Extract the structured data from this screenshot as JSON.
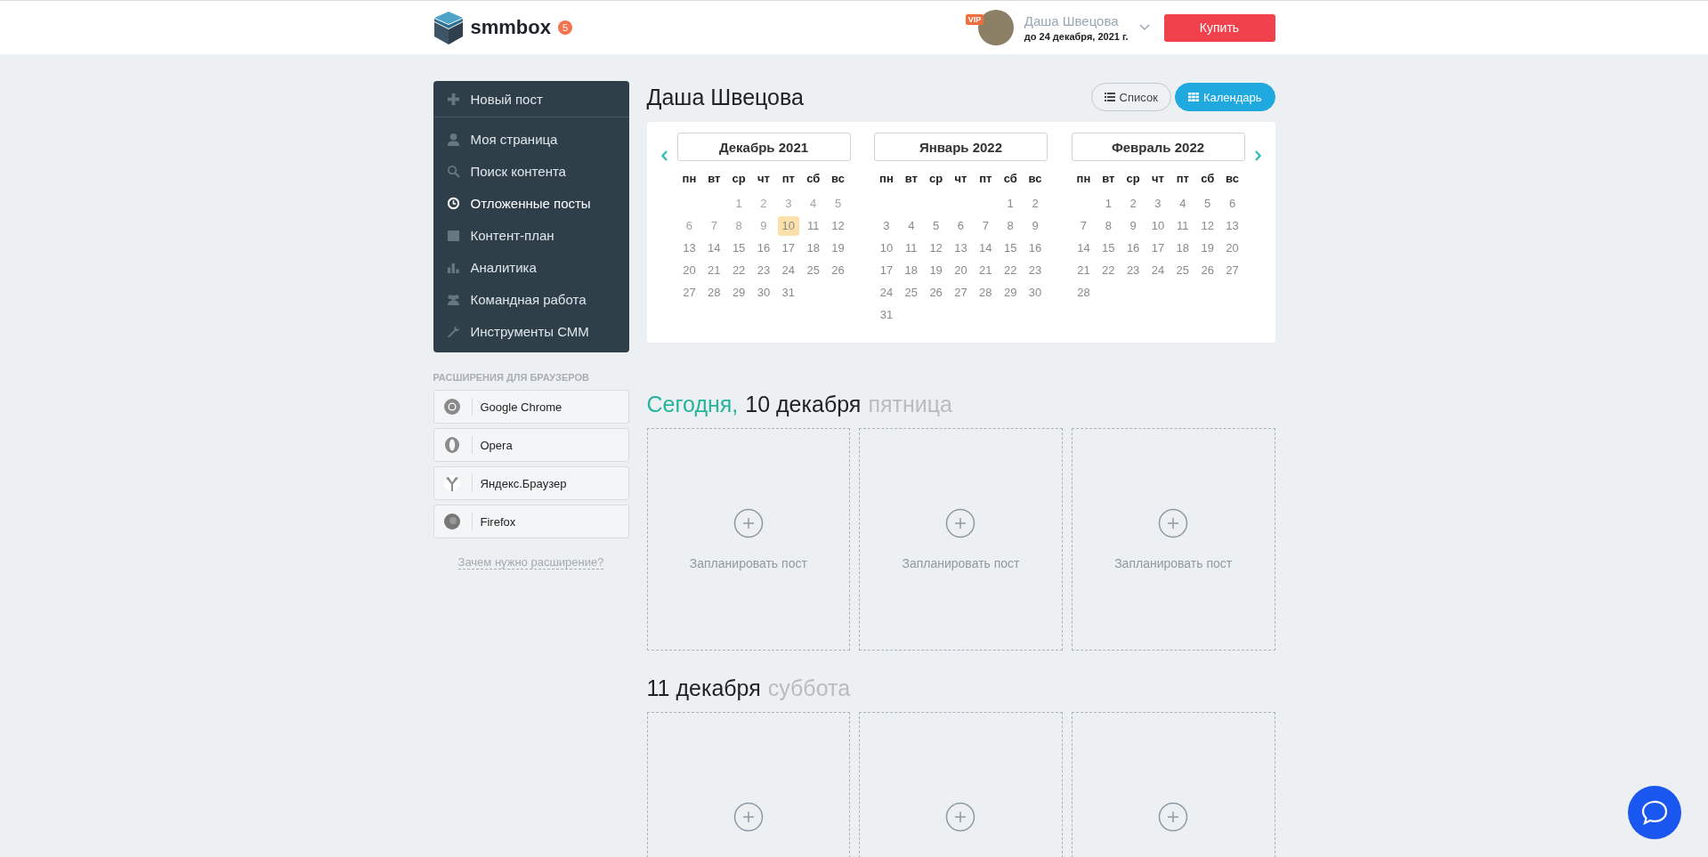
{
  "header": {
    "logo_text": "smmbox",
    "notification_count": "5",
    "vip_badge": "VIP",
    "user_name": "Даша Швецова",
    "subscription": "до 24 декабря, 2021 г.",
    "buy_button": "Купить"
  },
  "sidebar": {
    "items": [
      {
        "label": "Новый пост",
        "kind": "action",
        "selected": false
      },
      {
        "label": "Моя страница",
        "kind": "link",
        "selected": false
      },
      {
        "label": "Поиск контента",
        "kind": "link",
        "selected": false
      },
      {
        "label": "Отложенные посты",
        "kind": "link",
        "selected": true
      },
      {
        "label": "Контент-план",
        "kind": "link",
        "selected": false
      },
      {
        "label": "Аналитика",
        "kind": "link",
        "selected": false
      },
      {
        "label": "Командная работа",
        "kind": "link",
        "selected": false
      },
      {
        "label": "Инструменты СММ",
        "kind": "link",
        "selected": false
      }
    ],
    "extensions_heading": "РАСШИРЕНИЯ ДЛЯ БРАУЗЕРОВ",
    "extensions": [
      "Google Chrome",
      "Opera",
      "Яндекс.Браузер",
      "Firefox"
    ],
    "extensions_link": "Зачем нужно расширение?"
  },
  "page_title": "Даша Швецова",
  "view_tabs": [
    {
      "label": "Список",
      "selected": false
    },
    {
      "label": "Календарь",
      "selected": true
    }
  ],
  "months": [
    {
      "title": "Декабрь 2021",
      "weekdays": [
        "пн",
        "вт",
        "ср",
        "чт",
        "пт",
        "сб",
        "вс"
      ],
      "weeks": [
        [
          {
            "day": "1",
            "past": true,
            "selected": false
          },
          {
            "day": "2",
            "past": true,
            "selected": false
          },
          {
            "day": "3",
            "past": true,
            "selected": false
          },
          {
            "day": "4",
            "past": true,
            "selected": false
          },
          {
            "day": "5",
            "past": true,
            "selected": false
          }
        ],
        [
          {
            "day": "6",
            "past": true,
            "selected": false
          },
          {
            "day": "7",
            "past": true,
            "selected": false
          },
          {
            "day": "8",
            "past": true,
            "selected": false
          },
          {
            "day": "9",
            "past": true,
            "selected": false
          },
          {
            "day": "10",
            "past": false,
            "selected": true
          },
          {
            "day": "11",
            "past": false,
            "selected": false
          },
          {
            "day": "12",
            "past": false,
            "selected": false
          }
        ],
        [
          {
            "day": "13",
            "past": false,
            "selected": false
          },
          {
            "day": "14",
            "past": false,
            "selected": false
          },
          {
            "day": "15",
            "past": false,
            "selected": false
          },
          {
            "day": "16",
            "past": false,
            "selected": false
          },
          {
            "day": "17",
            "past": false,
            "selected": false
          },
          {
            "day": "18",
            "past": false,
            "selected": false
          },
          {
            "day": "19",
            "past": false,
            "selected": false
          }
        ],
        [
          {
            "day": "20",
            "past": false,
            "selected": false
          },
          {
            "day": "21",
            "past": false,
            "selected": false
          },
          {
            "day": "22",
            "past": false,
            "selected": false
          },
          {
            "day": "23",
            "past": false,
            "selected": false
          },
          {
            "day": "24",
            "past": false,
            "selected": false
          },
          {
            "day": "25",
            "past": false,
            "selected": false
          },
          {
            "day": "26",
            "past": false,
            "selected": false
          }
        ],
        [
          {
            "day": "27",
            "past": false,
            "selected": false
          },
          {
            "day": "28",
            "past": false,
            "selected": false
          },
          {
            "day": "29",
            "past": false,
            "selected": false
          },
          {
            "day": "30",
            "past": false,
            "selected": false
          },
          {
            "day": "31",
            "past": false,
            "selected": false
          }
        ]
      ]
    },
    {
      "title": "Январь 2022",
      "weekdays": [
        "пн",
        "вт",
        "ср",
        "чт",
        "пт",
        "сб",
        "вс"
      ],
      "weeks": [
        [
          {
            "day": "1",
            "past": false,
            "selected": false
          },
          {
            "day": "2",
            "past": false,
            "selected": false
          }
        ],
        [
          {
            "day": "3",
            "past": false,
            "selected": false
          },
          {
            "day": "4",
            "past": false,
            "selected": false
          },
          {
            "day": "5",
            "past": false,
            "selected": false
          },
          {
            "day": "6",
            "past": false,
            "selected": false
          },
          {
            "day": "7",
            "past": false,
            "selected": false
          },
          {
            "day": "8",
            "past": false,
            "selected": false
          },
          {
            "day": "9",
            "past": false,
            "selected": false
          }
        ],
        [
          {
            "day": "10",
            "past": false,
            "selected": false
          },
          {
            "day": "11",
            "past": false,
            "selected": false
          },
          {
            "day": "12",
            "past": false,
            "selected": false
          },
          {
            "day": "13",
            "past": false,
            "selected": false
          },
          {
            "day": "14",
            "past": false,
            "selected": false
          },
          {
            "day": "15",
            "past": false,
            "selected": false
          },
          {
            "day": "16",
            "past": false,
            "selected": false
          }
        ],
        [
          {
            "day": "17",
            "past": false,
            "selected": false
          },
          {
            "day": "18",
            "past": false,
            "selected": false
          },
          {
            "day": "19",
            "past": false,
            "selected": false
          },
          {
            "day": "20",
            "past": false,
            "selected": false
          },
          {
            "day": "21",
            "past": false,
            "selected": false
          },
          {
            "day": "22",
            "past": false,
            "selected": false
          },
          {
            "day": "23",
            "past": false,
            "selected": false
          }
        ],
        [
          {
            "day": "24",
            "past": false,
            "selected": false
          },
          {
            "day": "25",
            "past": false,
            "selected": false
          },
          {
            "day": "26",
            "past": false,
            "selected": false
          },
          {
            "day": "27",
            "past": false,
            "selected": false
          },
          {
            "day": "28",
            "past": false,
            "selected": false
          },
          {
            "day": "29",
            "past": false,
            "selected": false
          },
          {
            "day": "30",
            "past": false,
            "selected": false
          }
        ],
        [
          {
            "day": "31",
            "past": false,
            "selected": false
          }
        ]
      ]
    },
    {
      "title": "Февраль 2022",
      "weekdays": [
        "пн",
        "вт",
        "ср",
        "чт",
        "пт",
        "сб",
        "вс"
      ],
      "weeks": [
        [
          {
            "day": "1",
            "past": false,
            "selected": false
          },
          {
            "day": "2",
            "past": false,
            "selected": false
          },
          {
            "day": "3",
            "past": false,
            "selected": false
          },
          {
            "day": "4",
            "past": false,
            "selected": false
          },
          {
            "day": "5",
            "past": false,
            "selected": false
          },
          {
            "day": "6",
            "past": false,
            "selected": false
          }
        ],
        [
          {
            "day": "7",
            "past": false,
            "selected": false
          },
          {
            "day": "8",
            "past": false,
            "selected": false
          },
          {
            "day": "9",
            "past": false,
            "selected": false
          },
          {
            "day": "10",
            "past": false,
            "selected": false
          },
          {
            "day": "11",
            "past": false,
            "selected": false
          },
          {
            "day": "12",
            "past": false,
            "selected": false
          },
          {
            "day": "13",
            "past": false,
            "selected": false
          }
        ],
        [
          {
            "day": "14",
            "past": false,
            "selected": false
          },
          {
            "day": "15",
            "past": false,
            "selected": false
          },
          {
            "day": "16",
            "past": false,
            "selected": false
          },
          {
            "day": "17",
            "past": false,
            "selected": false
          },
          {
            "day": "18",
            "past": false,
            "selected": false
          },
          {
            "day": "19",
            "past": false,
            "selected": false
          },
          {
            "day": "20",
            "past": false,
            "selected": false
          }
        ],
        [
          {
            "day": "21",
            "past": false,
            "selected": false
          },
          {
            "day": "22",
            "past": false,
            "selected": false
          },
          {
            "day": "23",
            "past": false,
            "selected": false
          },
          {
            "day": "24",
            "past": false,
            "selected": false
          },
          {
            "day": "25",
            "past": false,
            "selected": false
          },
          {
            "day": "26",
            "past": false,
            "selected": false
          },
          {
            "day": "27",
            "past": false,
            "selected": false
          }
        ],
        [
          {
            "day": "28",
            "past": false,
            "selected": false
          }
        ]
      ]
    }
  ],
  "days": [
    {
      "today_label": "Сегодня,",
      "date": "10 декабря",
      "weekday": "пятница",
      "slots": [
        {
          "kind": "labeled",
          "label": "Запланировать пост"
        },
        {
          "kind": "labeled",
          "label": "Запланировать пост"
        },
        {
          "kind": "labeled",
          "label": "Запланировать пост"
        }
      ]
    },
    {
      "date": "11 декабря",
      "weekday": "суббота",
      "slots": [
        {
          "kind": "cut"
        },
        {
          "kind": "cut"
        },
        {
          "kind": "cut"
        }
      ]
    }
  ]
}
